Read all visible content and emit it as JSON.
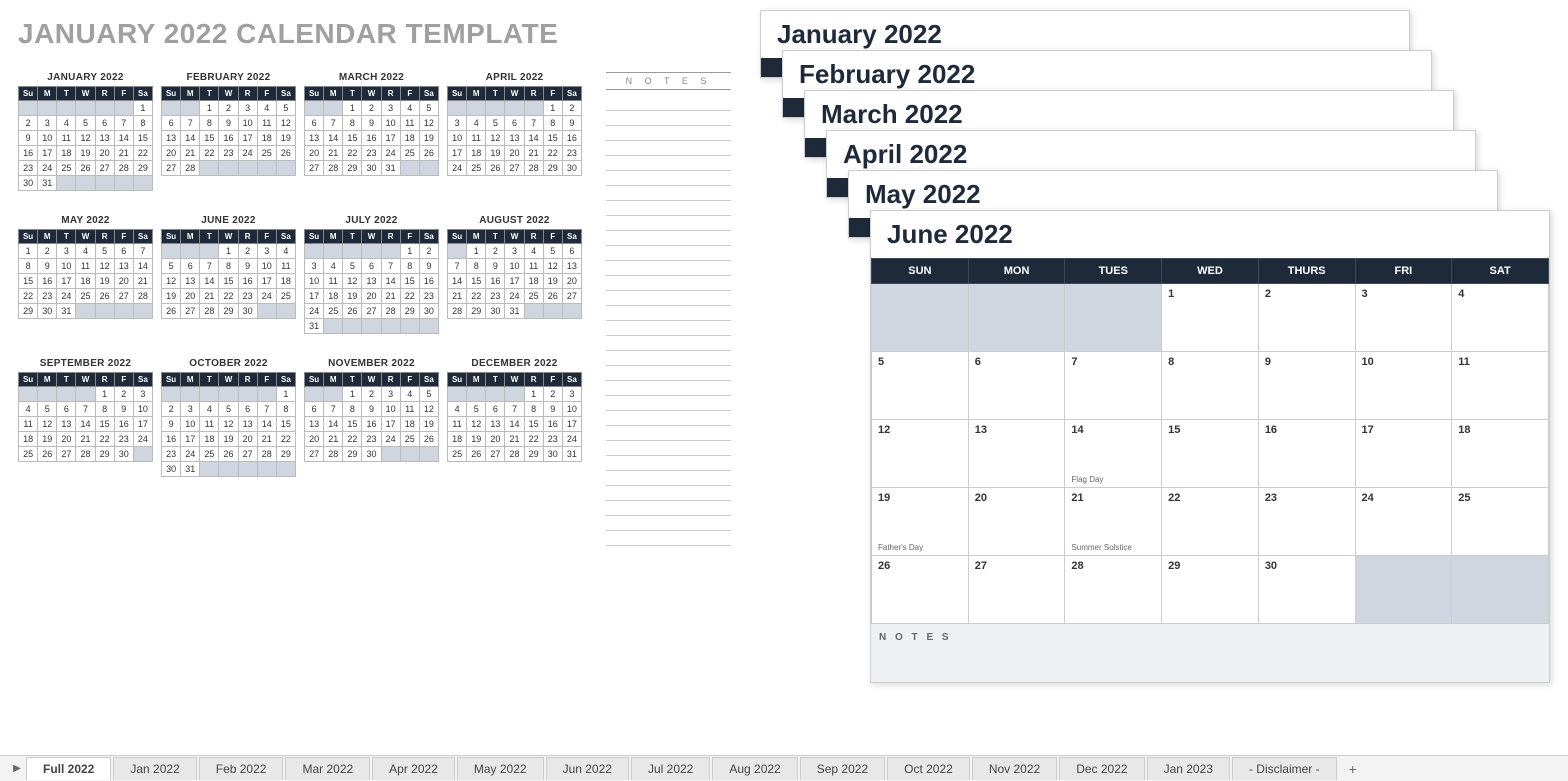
{
  "title": "JANUARY 2022 CALENDAR TEMPLATE",
  "notes_label": "N O T E S",
  "dow_short": [
    "Su",
    "M",
    "T",
    "W",
    "R",
    "F",
    "Sa"
  ],
  "dow_long": [
    "SUN",
    "MON",
    "TUES",
    "WED",
    "THURS",
    "FRI",
    "SAT"
  ],
  "months": [
    {
      "name": "JANUARY 2022",
      "start": 6,
      "days": 31
    },
    {
      "name": "FEBRUARY 2022",
      "start": 2,
      "days": 28
    },
    {
      "name": "MARCH 2022",
      "start": 2,
      "days": 31
    },
    {
      "name": "APRIL 2022",
      "start": 5,
      "days": 30
    },
    {
      "name": "MAY 2022",
      "start": 0,
      "days": 31
    },
    {
      "name": "JUNE 2022",
      "start": 3,
      "days": 30
    },
    {
      "name": "JULY 2022",
      "start": 5,
      "days": 31
    },
    {
      "name": "AUGUST 2022",
      "start": 1,
      "days": 31
    },
    {
      "name": "SEPTEMBER 2022",
      "start": 4,
      "days": 30
    },
    {
      "name": "OCTOBER 2022",
      "start": 6,
      "days": 31
    },
    {
      "name": "NOVEMBER 2022",
      "start": 2,
      "days": 30
    },
    {
      "name": "DECEMBER 2022",
      "start": 4,
      "days": 31
    }
  ],
  "stack": [
    {
      "title": "January 2022"
    },
    {
      "title": "February 2022"
    },
    {
      "title": "March 2022"
    },
    {
      "title": "April 2022"
    },
    {
      "title": "May 2022"
    }
  ],
  "june": {
    "title": "June 2022",
    "start": 3,
    "days": 30,
    "events": {
      "14": "Flag Day",
      "19": "Father's Day",
      "21": "Summer Solstice"
    },
    "notes": "N O T E S"
  },
  "tabs": [
    "Full 2022",
    "Jan 2022",
    "Feb 2022",
    "Mar 2022",
    "Apr 2022",
    "May 2022",
    "Jun 2022",
    "Jul 2022",
    "Aug 2022",
    "Sep 2022",
    "Oct 2022",
    "Nov 2022",
    "Dec 2022",
    "Jan 2023",
    "- Disclaimer -"
  ],
  "active_tab": 0
}
